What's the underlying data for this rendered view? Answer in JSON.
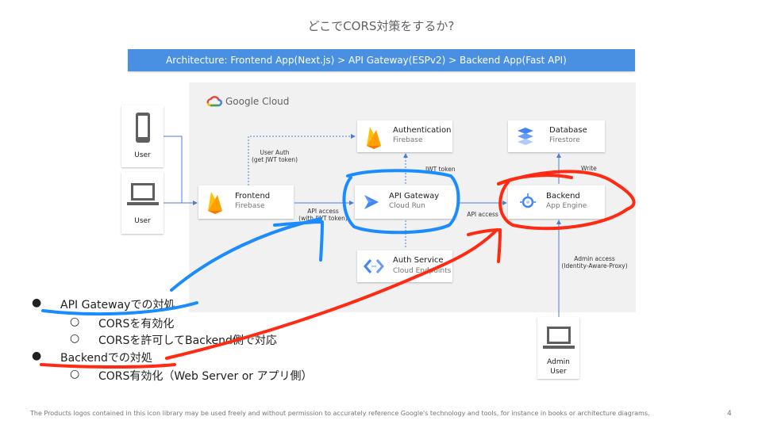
{
  "slide": {
    "title": "どこでCORS対策をするか?",
    "banner": "Architecture: Frontend App(Next.js) > API Gateway(ESPv2) > Backend App(Fast API)",
    "footer": "The Products logos contained in this icon library may be used freely and without permission to accurately reference Google's technology and tools, for instance in books or architecture diagrams.",
    "page_number": "4"
  },
  "diagram": {
    "cloud_label": "Google Cloud",
    "devices": [
      {
        "label": "User",
        "icon": "smartphone-icon"
      },
      {
        "label": "User",
        "icon": "laptop-icon"
      },
      {
        "label": "Admin\nUser",
        "icon": "laptop-icon"
      }
    ],
    "services": {
      "authentication": {
        "title": "Authentication",
        "sub": "Firebase",
        "icon": "firebase-icon"
      },
      "database": {
        "title": "Database",
        "sub": "Firestore",
        "icon": "firestore-icon"
      },
      "frontend": {
        "title": "Frontend",
        "sub": "Firebase",
        "icon": "firebase-icon"
      },
      "api_gateway": {
        "title": "API Gateway",
        "sub": "Cloud Run",
        "icon": "api-gateway-icon"
      },
      "backend": {
        "title": "Backend",
        "sub": "App Engine",
        "icon": "app-engine-icon"
      },
      "auth_service": {
        "title": "Auth Service",
        "sub": "Cloud Endpoints",
        "icon": "cloud-endpoints-icon"
      }
    },
    "edge_labels": {
      "user_auth": "User Auth\n(get JWT token)",
      "api_access_jwt": "API access\n(with JWT token)",
      "jwt_token": "JWT token",
      "api_access": "API access",
      "write": "Write",
      "admin_access": "Admin access\n(Identity-Aware-Proxy)"
    }
  },
  "bullets": [
    {
      "text": "API Gatewayでの対処",
      "children": [
        "CORSを有効化",
        "CORSを許可してBackend側で対応"
      ]
    },
    {
      "text": "Backendでの対処",
      "children": [
        "CORS有効化（Web Server or アプリ側）"
      ]
    }
  ],
  "colors": {
    "banner": "#4a90e2",
    "canvas": "#f1f1f1",
    "arrow": "#4a7fd6",
    "annotation_blue": "#1a8cff",
    "annotation_red": "#ff2a12",
    "firebase": "#ffa000"
  }
}
